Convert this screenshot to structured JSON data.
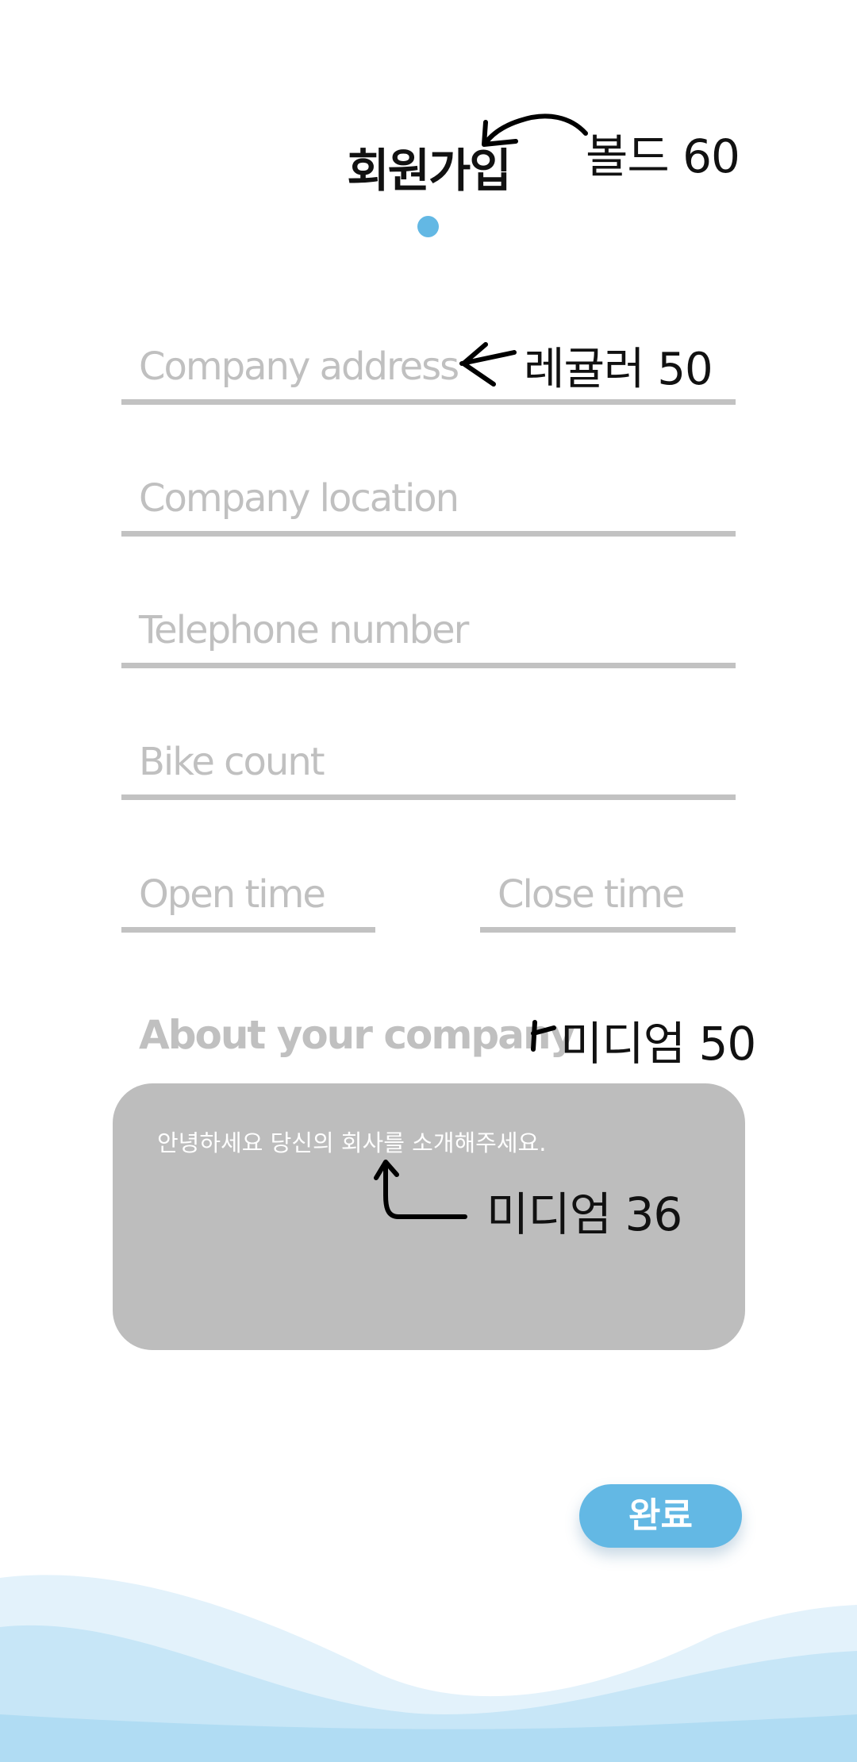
{
  "header": {
    "title": "회원가입"
  },
  "form": {
    "company_address": {
      "placeholder": "Company address"
    },
    "company_location": {
      "placeholder": "Company location"
    },
    "telephone_number": {
      "placeholder": "Telephone number"
    },
    "bike_count": {
      "placeholder": "Bike count"
    },
    "open_time": {
      "placeholder": "Open time"
    },
    "close_time": {
      "placeholder": "Close time"
    },
    "about": {
      "label": "About your company",
      "placeholder": "안녕하세요 당신의 회사를 소개해주세요."
    }
  },
  "actions": {
    "done_label": "완료"
  },
  "annotations": {
    "title_note": "볼드 60",
    "field_note": "레귤러 50",
    "label_note": "미디엄 50",
    "text_note": "미디엄 36"
  },
  "colors": {
    "accent": "#63b8e4",
    "placeholder": "#c0c0c0",
    "underline": "#c2c2c2",
    "textarea_bg": "#bdbdbd",
    "wave_light": "#e3f2fb",
    "wave_mid": "#c7e6f7",
    "wave_dark": "#b0dcf3"
  }
}
